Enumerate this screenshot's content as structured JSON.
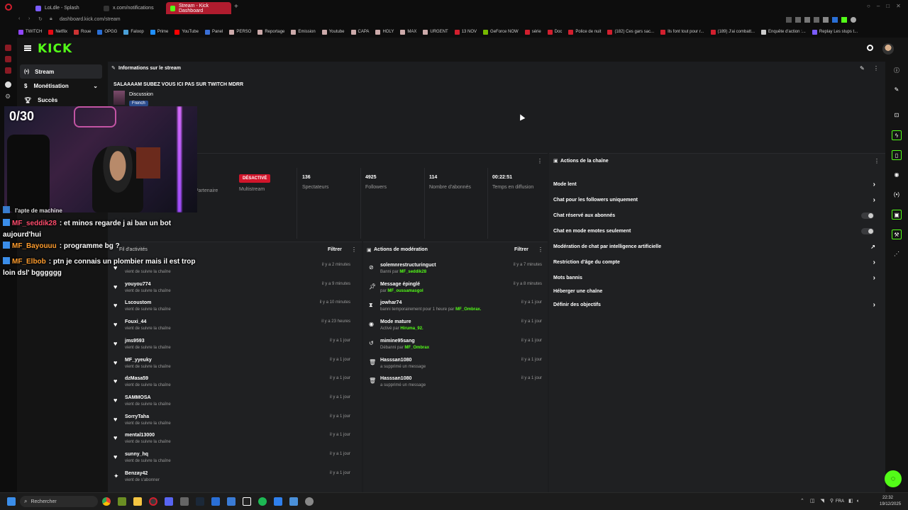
{
  "browser": {
    "tabs": [
      {
        "label": "LoLdle - Splash",
        "color": "#7b5cff"
      },
      {
        "label": "x.com/notifications",
        "color": "#222222"
      },
      {
        "label": "Stream - Kick Dashboard",
        "color": "#53fc18"
      }
    ],
    "url": "dashboard.kick.com/stream",
    "bookmarks": [
      "TWITCH",
      "Netflix",
      "Roue",
      "OPGG",
      "Faloop",
      "Prime",
      "YouTube",
      "Panel",
      "PERSO",
      "Reportage",
      "Emission",
      "Youtube",
      "CAPA",
      "HOLY",
      "MAX",
      "URGENT",
      "13 NOV",
      "GeForce NOW",
      "série",
      "Doc",
      "Police de nuit",
      "(182) Ces gars sac...",
      "Ils font tout pour r...",
      "(189) J'ai combatt...",
      "Enquête d'action :...",
      "Replay Les stups t..."
    ]
  },
  "brand": {
    "logo": "KICK",
    "accent": "#53fc18"
  },
  "sidebar": {
    "items": [
      {
        "label": "Stream"
      },
      {
        "label": "Monétisation"
      },
      {
        "label": "Succès"
      }
    ]
  },
  "stream_info": {
    "title": "Informations sur le stream",
    "stream_title": "SALAAAAM SUBEZ VOUS ICI PAS SUR TWITCH MDRR",
    "category": "Discussion",
    "language_badge": "French"
  },
  "stats": {
    "partner_label": "Partenaire",
    "multistream_badge": "DÉSACTIVÉ",
    "multistream_label": "Multistream",
    "viewers_value": "136",
    "viewers_label": "Spectateurs",
    "followers_value": "4925",
    "followers_label": "Followers",
    "subs_value": "114",
    "subs_label": "Nombre d'abonnés",
    "uptime_value": "00:22:51",
    "uptime_label": "Temps en diffusion"
  },
  "activity": {
    "title": "Fil d'activités",
    "filter_label": "Filtrer",
    "items": [
      {
        "name": "",
        "sub": "vient de suivre la chaîne",
        "time": "il y a 2 minutes",
        "icon": "heart"
      },
      {
        "name": "youyou774",
        "sub": "vient de suivre la chaîne",
        "time": "il y a 9 minutes",
        "icon": "heart"
      },
      {
        "name": "Lscoustom",
        "sub": "vient de suivre la chaîne",
        "time": "il y a 10 minutes",
        "icon": "heart"
      },
      {
        "name": "Fouxi_44",
        "sub": "vient de suivre la chaîne",
        "time": "il y a 23 heures",
        "icon": "heart"
      },
      {
        "name": "jms9593",
        "sub": "vient de suivre la chaîne",
        "time": "il y a 1 jour",
        "icon": "heart"
      },
      {
        "name": "MF_yyeuky",
        "sub": "vient de suivre la chaîne",
        "time": "il y a 1 jour",
        "icon": "heart"
      },
      {
        "name": "dzMasa59",
        "sub": "vient de suivre la chaîne",
        "time": "il y a 1 jour",
        "icon": "heart"
      },
      {
        "name": "SAMMOSA",
        "sub": "vient de suivre la chaîne",
        "time": "il y a 1 jour",
        "icon": "heart"
      },
      {
        "name": "SorryTaha",
        "sub": "vient de suivre la chaîne",
        "time": "il y a 1 jour",
        "icon": "heart"
      },
      {
        "name": "mental13000",
        "sub": "vient de suivre la chaîne",
        "time": "il y a 1 jour",
        "icon": "heart"
      },
      {
        "name": "sunny_hq",
        "sub": "vient de suivre la chaîne",
        "time": "il y a 1 jour",
        "icon": "heart"
      },
      {
        "name": "Benzay42",
        "sub": "vient de s'abonner",
        "time": "il y a 1 jour",
        "icon": "star"
      }
    ]
  },
  "moderation": {
    "title": "Actions de modération",
    "filter_label": "Filtrer",
    "items": [
      {
        "name": "solemnrestructuringuct",
        "sub": "Banni par",
        "by": "MF_seddik28",
        "time": "il y a 7 minutes",
        "icon": "ban"
      },
      {
        "name": "Message épinglé",
        "sub": "par",
        "by": "MF_oussamasgol",
        "time": "il y a 8 minutes",
        "icon": "pin"
      },
      {
        "name": "jowhar74",
        "sub": "banni temporairement pour 1 heure par",
        "by": "MF_Ombrax.",
        "time": "il y a 1 jour",
        "icon": "timer"
      },
      {
        "name": "Mode mature",
        "sub": "Activé par",
        "by": "Hiruma_92.",
        "time": "il y a 1 jour",
        "icon": "eye"
      },
      {
        "name": "mimine95sang",
        "sub": "Débanni par",
        "by": "MF_Ombrax",
        "time": "il y a 1 jour",
        "icon": "undo"
      },
      {
        "name": "Hasssan1080",
        "sub": "a supprimé un message",
        "by": "",
        "time": "il y a 1 jour",
        "icon": "trash"
      },
      {
        "name": "Hasssan1080",
        "sub": "a supprimé un message",
        "by": "",
        "time": "il y a 1 jour",
        "icon": "trash"
      }
    ]
  },
  "channel_actions": {
    "title": "Actions de la chaîne",
    "items": [
      {
        "label": "Mode lent",
        "control": "chevron"
      },
      {
        "label": "Chat pour les followers uniquement",
        "control": "chevron"
      },
      {
        "label": "Chat réservé aux abonnés",
        "control": "toggle"
      },
      {
        "label": "Chat en mode emotes seulement",
        "control": "toggle"
      },
      {
        "label": "Modération de chat par intelligence artificielle",
        "control": "external"
      },
      {
        "label": "Restriction d'âge du compte",
        "control": "chevron"
      },
      {
        "label": "Mots bannis",
        "control": "chevron"
      },
      {
        "label": "Héberger une chaîne",
        "control": "none"
      },
      {
        "label": "Définir des objectifs",
        "control": "chevron"
      }
    ]
  },
  "overlay": {
    "counter": "0/30",
    "chat": [
      {
        "user": "",
        "msg": "l'apte de machine",
        "color": "#ff4d6d"
      },
      {
        "user": "MF_seddik28",
        "msg": ": et minos regarde j ai ban un bot aujourd'hui",
        "color": "#ff4d6d"
      },
      {
        "user": "MF_Bayouuu",
        "msg": ": programme bg ?",
        "color": "#ff9d2e"
      },
      {
        "user": "MF_Elbob",
        "msg": ": ptn je connais un plombier mais il est trop loin dsl' bgggggg",
        "color": "#ff9d2e"
      }
    ]
  },
  "taskbar": {
    "search_placeholder": "Rechercher",
    "lang": "FRA",
    "time": "22:32",
    "date": "19/12/2025"
  }
}
